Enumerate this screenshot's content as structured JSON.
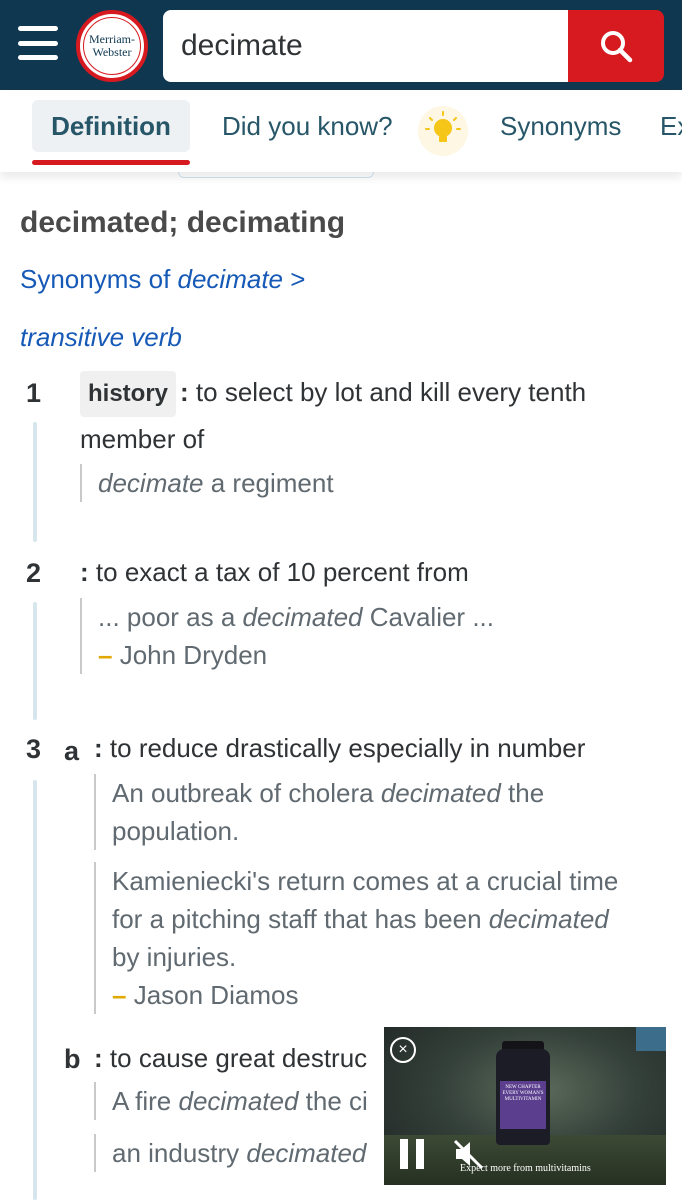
{
  "header": {
    "logo_line1": "Merriam-",
    "logo_line2": "Webster",
    "search_value": "decimate"
  },
  "tabs": {
    "definition": "Definition",
    "did_you_know": "Did you know?",
    "synonyms": "Synonyms",
    "examples_peek": "Ex"
  },
  "entry": {
    "inflections": "decimated; decimating",
    "synonyms_link_prefix": "Synonyms of ",
    "synonyms_link_word": "decimate",
    "synonyms_link_chevron": ">",
    "part_of_speech": "transitive verb"
  },
  "senses": [
    {
      "number": "1",
      "label": "history",
      "definition": "to select by lot and kill every tenth member of",
      "examples": [
        {
          "italic": "decimate",
          "rest": " a regiment"
        }
      ]
    },
    {
      "number": "2",
      "definition": "to exact a tax of 10 percent from",
      "examples": [
        {
          "before": "... poor as a ",
          "italic": "decimated",
          "after": " Cavalier ...",
          "author": "John Dryden"
        }
      ]
    },
    {
      "number": "3",
      "letter": "a",
      "definition": "to reduce drastically especially in number",
      "examples": [
        {
          "before": "An outbreak of cholera ",
          "italic": "decimated",
          "after": " the population."
        },
        {
          "before": "Kamieniecki's return comes at a crucial time for a pitching staff that has been ",
          "italic": "decimated",
          "after": " by injuries.",
          "author": "Jason Diamos"
        }
      ]
    },
    {
      "letter": "b",
      "definition": "to cause great destruc",
      "examples": [
        {
          "before": "A fire ",
          "italic": "decimated",
          "after": " the ci"
        },
        {
          "before": "an industry ",
          "italic": "decimated",
          "after": ""
        }
      ]
    }
  ],
  "ad": {
    "cta": "Expect more from multivitamins",
    "bottle_text": "NEW CHAPTER EVERY WOMAN'S MULTIVITAMIN",
    "close_symbol": "×"
  },
  "colors": {
    "header_bg": "#0f3850",
    "brand_red": "#d71920",
    "link_blue": "#1659b6",
    "tab_text": "#265667",
    "author_dash": "#e0a800"
  }
}
